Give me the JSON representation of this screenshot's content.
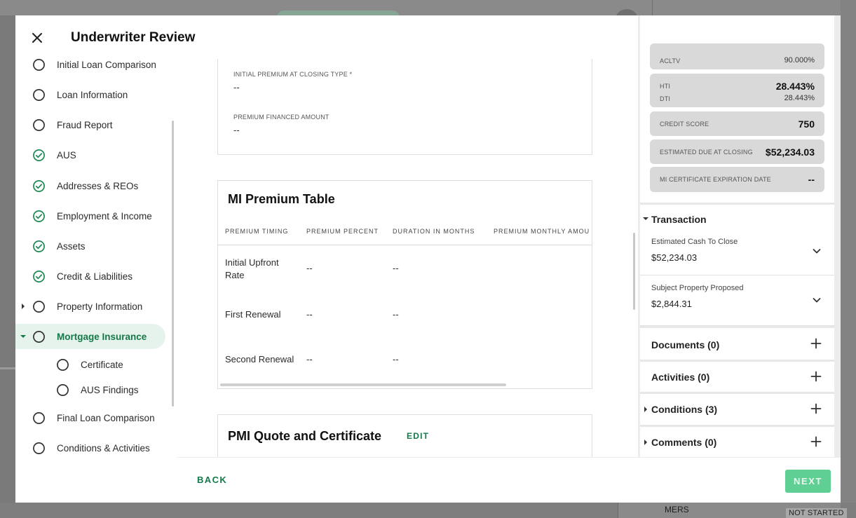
{
  "modal": {
    "title": "Underwriter Review"
  },
  "sidebar": {
    "items": [
      {
        "label": "Initial Loan Comparison",
        "status": "incomplete"
      },
      {
        "label": "Loan Information",
        "status": "incomplete"
      },
      {
        "label": "Fraud Report",
        "status": "incomplete"
      },
      {
        "label": "AUS",
        "status": "complete"
      },
      {
        "label": "Addresses & REOs",
        "status": "complete"
      },
      {
        "label": "Employment & Income",
        "status": "complete"
      },
      {
        "label": "Assets",
        "status": "complete"
      },
      {
        "label": "Credit & Liabilities",
        "status": "complete"
      },
      {
        "label": "Property Information",
        "status": "incomplete"
      },
      {
        "label": "Mortgage Insurance",
        "status": "incomplete"
      },
      {
        "label": "Certificate",
        "status": "incomplete"
      },
      {
        "label": "AUS Findings",
        "status": "incomplete"
      },
      {
        "label": "Final Loan Comparison",
        "status": "incomplete"
      },
      {
        "label": "Conditions & Activities",
        "status": "incomplete"
      }
    ]
  },
  "premium_card": {
    "initial_premium_label": "INITIAL PREMIUM AT CLOSING TYPE *",
    "initial_premium_value": "--",
    "financed_label": "PREMIUM FINANCED AMOUNT",
    "financed_value": "--"
  },
  "mi_table": {
    "title": "MI Premium Table",
    "columns": [
      "PREMIUM TIMING",
      "PREMIUM PERCENT",
      "DURATION IN MONTHS",
      "PREMIUM MONTHLY AMOU"
    ],
    "rows": [
      {
        "timing": "Initial Upfront Rate",
        "percent": "--",
        "duration": "--"
      },
      {
        "timing": "First Renewal",
        "percent": "--",
        "duration": "--"
      },
      {
        "timing": "Second Renewal",
        "percent": "--",
        "duration": "--"
      }
    ]
  },
  "pmi_card": {
    "title": "PMI Quote and Certificate",
    "edit_label": "EDIT"
  },
  "metrics": {
    "acltv_label": "ACLTV",
    "acltv_value": "90.000%",
    "hti_label": "HTI",
    "hti_value": "28.443%",
    "dti_label": "DTI",
    "dti_value": "28.443%",
    "credit_label": "CREDIT SCORE",
    "credit_value": "750",
    "due_label": "ESTIMATED DUE AT CLOSING",
    "due_value": "$52,234.03",
    "mi_exp_label": "MI CERTIFICATE EXPIRATION DATE",
    "mi_exp_value": "--"
  },
  "transaction": {
    "title": "Transaction",
    "items": [
      {
        "label": "Estimated Cash To Close",
        "value": "$52,234.03"
      },
      {
        "label": "Subject Property Proposed",
        "value": "$2,844.31"
      }
    ]
  },
  "sections": {
    "documents": "Documents (0)",
    "activities": "Activities (0)",
    "conditions": "Conditions (3)",
    "comments": "Comments (0)"
  },
  "footer": {
    "back_label": "BACK",
    "next_label": "NEXT"
  },
  "background": {
    "mers_label": "MERS",
    "status_label": "NOT STARTED"
  },
  "colors": {
    "accent": "#137a47",
    "complete": "#1f8a55",
    "next_button": "#5fcf94"
  }
}
